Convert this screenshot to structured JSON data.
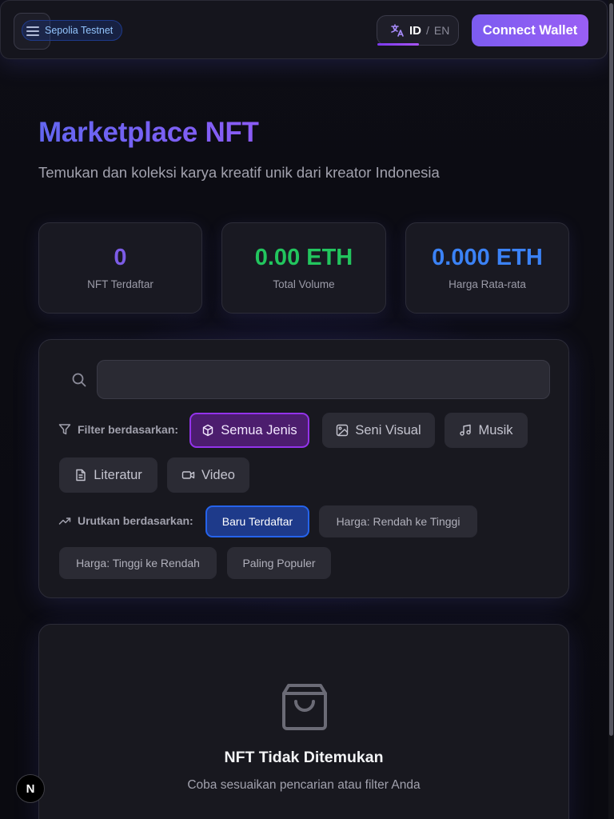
{
  "header": {
    "network_badge": "Sepolia Testnet",
    "language": {
      "active": "ID",
      "separator": "/",
      "other": "EN"
    },
    "connect_label": "Connect Wallet"
  },
  "hero": {
    "title": "Marketplace NFT",
    "subtitle": "Temukan dan koleksi karya kreatif unik dari kreator Indonesia"
  },
  "stats": [
    {
      "value": "0",
      "label": "NFT Terdaftar",
      "color": "#7c5ce6"
    },
    {
      "value": "0.00 ETH",
      "label": "Total Volume",
      "color": "#22c55e"
    },
    {
      "value": "0.000 ETH",
      "label": "Harga Rata-rata",
      "color": "#3b82f6"
    }
  ],
  "filters": {
    "search_placeholder": "",
    "type_label": "Filter berdasarkan:",
    "types": [
      {
        "label": "Semua Jenis",
        "icon": "box-icon",
        "active": true
      },
      {
        "label": "Seni Visual",
        "icon": "image-icon",
        "active": false
      },
      {
        "label": "Musik",
        "icon": "music-icon",
        "active": false
      },
      {
        "label": "Literatur",
        "icon": "document-icon",
        "active": false
      },
      {
        "label": "Video",
        "icon": "video-icon",
        "active": false
      }
    ],
    "sort_label": "Urutkan berdasarkan:",
    "sorts": [
      {
        "label": "Baru Terdaftar",
        "active": true
      },
      {
        "label": "Harga: Rendah ke Tinggi",
        "active": false
      },
      {
        "label": "Harga: Tinggi ke Rendah",
        "active": false
      },
      {
        "label": "Paling Populer",
        "active": false
      }
    ]
  },
  "empty_state": {
    "icon": "shopping-bag-icon",
    "title": "NFT Tidak Ditemukan",
    "description": "Coba sesuaikan pencarian atau filter Anda"
  },
  "dev_badge": "N",
  "colors": {
    "accent": "#8b5cf6",
    "active_type": "#9333ea",
    "active_sort": "#2563eb"
  }
}
